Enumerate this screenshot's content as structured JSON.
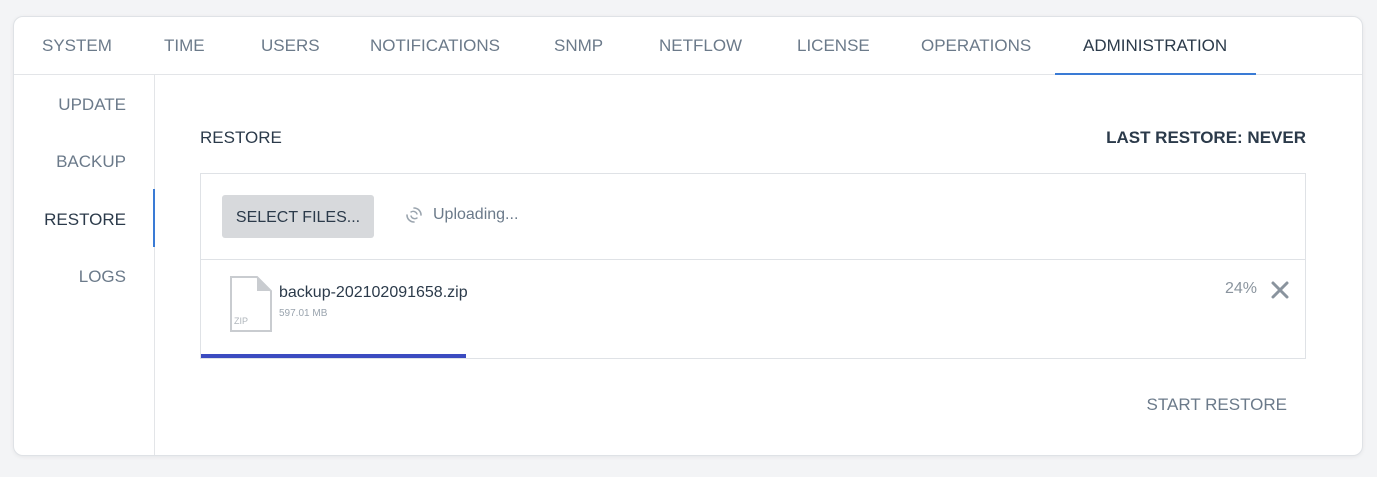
{
  "tabs": [
    {
      "label": "SYSTEM"
    },
    {
      "label": "TIME"
    },
    {
      "label": "USERS"
    },
    {
      "label": "NOTIFICATIONS"
    },
    {
      "label": "SNMP"
    },
    {
      "label": "NETFLOW"
    },
    {
      "label": "LICENSE"
    },
    {
      "label": "OPERATIONS"
    },
    {
      "label": "ADMINISTRATION",
      "active": true
    }
  ],
  "sidebar": {
    "items": [
      {
        "label": "UPDATE"
      },
      {
        "label": "BACKUP"
      },
      {
        "label": "RESTORE",
        "active": true
      },
      {
        "label": "LOGS"
      }
    ]
  },
  "main": {
    "section_title": "RESTORE",
    "last_restore": "LAST RESTORE: NEVER",
    "select_files_label": "SELECT FILES...",
    "upload_status": "Uploading...",
    "file": {
      "name": "backup-202102091658.zip",
      "size": "597.01 MB",
      "type_label": "ZIP",
      "progress_text": "24%",
      "progress_fraction": 0.24
    },
    "start_restore_label": "START RESTORE"
  },
  "colors": {
    "accent": "#3a7bd5",
    "progress": "#3b4bc0",
    "text_dark": "#2b3a4a",
    "text_muted": "#6b7a8a"
  },
  "icons": {
    "spinner": "spinner-icon",
    "file": "zip-file-icon",
    "remove": "close-icon"
  }
}
